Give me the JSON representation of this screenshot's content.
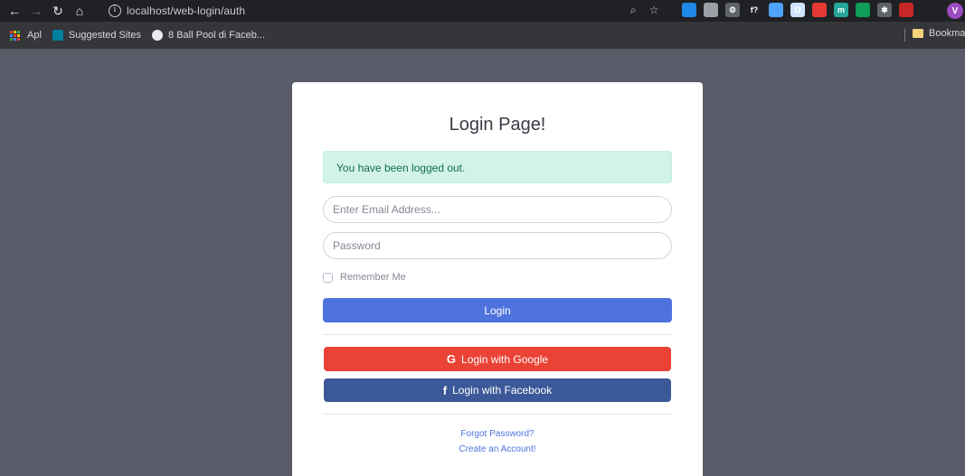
{
  "browser": {
    "url": "localhost/web-login/auth",
    "nav": {
      "back": "←",
      "forward": "→",
      "reload": "↻",
      "home": "⌂"
    },
    "info_glyph": "i",
    "zoom_glyph": "⌕",
    "star_glyph": "☆",
    "avatar_letter": "V",
    "extensions": [
      {
        "icon": "ext-blue-square-icon",
        "color": "#1e88e5",
        "glyph": ""
      },
      {
        "icon": "ext-globe-icon",
        "color": "#9aa0a6",
        "glyph": ""
      },
      {
        "icon": "ext-gear-icon",
        "color": "#5f6368",
        "glyph": "⚙"
      },
      {
        "icon": "ext-formula-icon",
        "color": "#202124",
        "glyph": "f?"
      },
      {
        "icon": "ext-circle-blue-icon",
        "color": "#4fa3ff",
        "glyph": ""
      },
      {
        "icon": "ext-ring-icon",
        "color": "#d0e4ff",
        "glyph": "O"
      },
      {
        "icon": "ext-new-badge-icon",
        "color": "#e53935",
        "glyph": ""
      },
      {
        "icon": "ext-m-icon",
        "color": "#26a69a",
        "glyph": "m"
      },
      {
        "icon": "ext-green-leaf-icon",
        "color": "#0f9d58",
        "glyph": ""
      },
      {
        "icon": "ext-puzzle-icon",
        "color": "#5f6368",
        "glyph": "✱"
      },
      {
        "icon": "ext-red-shield-icon",
        "color": "#c62828",
        "glyph": ""
      }
    ]
  },
  "bookmarks": {
    "apps": "Apl",
    "suggested": "Suggested Sites",
    "item3": "8 Ball Pool di Faceb...",
    "other": "Bookmar"
  },
  "page": {
    "title": "Login Page!",
    "alert": "You have been logged out.",
    "email_placeholder": "Enter Email Address...",
    "password_placeholder": "Password",
    "remember_label": "Remember Me",
    "login_button": "Login",
    "google_button": "Login with Google",
    "google_glyph": "G",
    "facebook_button": "Login with Facebook",
    "facebook_glyph": "f",
    "forgot_link": "Forgot Password?",
    "create_link": "Create an Account!"
  },
  "colors": {
    "background": "#5a5c69",
    "primary": "#4e73df",
    "google": "#ea4335",
    "facebook": "#3b5998",
    "alert_bg": "#d4f3e7"
  }
}
